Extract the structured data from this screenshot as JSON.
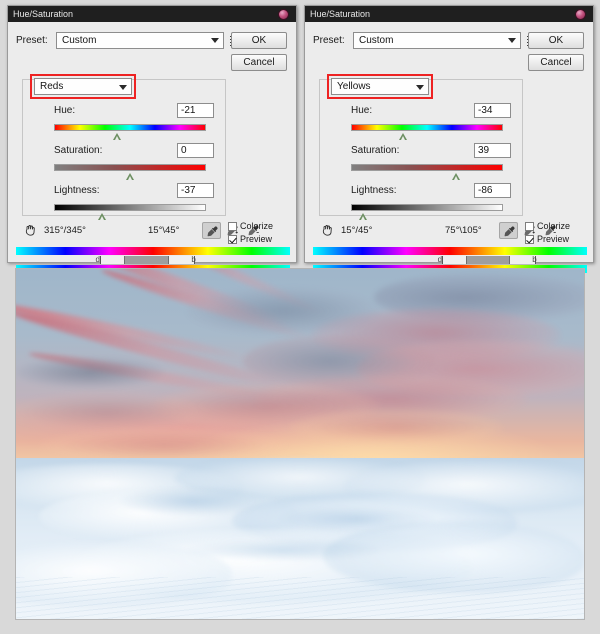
{
  "app": {
    "dialog_title": "Hue/Saturation"
  },
  "dialogs": [
    {
      "id": "reds",
      "title": "Hue/Saturation",
      "preset_label": "Preset:",
      "preset_value": "Custom",
      "buttons": {
        "ok": "OK",
        "cancel": "Cancel"
      },
      "channel": "Reds",
      "sliders": [
        {
          "name": "Hue:",
          "value": "-21",
          "thumb_pct": 41
        },
        {
          "name": "Saturation:",
          "value": "0",
          "thumb_pct": 50
        },
        {
          "name": "Lightness:",
          "value": "-37",
          "thumb_pct": 31
        }
      ],
      "range_left": "315°/345°",
      "range_right": "15°\\45°",
      "colorize_label": "Colorize",
      "colorize_checked": false,
      "preview_label": "Preview",
      "preview_checked": true,
      "spectrum": {
        "fall_start_pct": 30.5,
        "core_start_pct": 39.5,
        "core_end_pct": 56.0,
        "fall_end_pct": 65.0,
        "mark_left": "d",
        "mark_right": "b"
      }
    },
    {
      "id": "yellows",
      "title": "Hue/Saturation",
      "preset_label": "Preset:",
      "preset_value": "Custom",
      "buttons": {
        "ok": "OK",
        "cancel": "Cancel"
      },
      "channel": "Yellows",
      "sliders": [
        {
          "name": "Hue:",
          "value": "-34",
          "thumb_pct": 34
        },
        {
          "name": "Saturation:",
          "value": "39",
          "thumb_pct": 69
        },
        {
          "name": "Lightness:",
          "value": "-86",
          "thumb_pct": 7
        }
      ],
      "range_left": "15°/45°",
      "range_right": "75°\\105°",
      "colorize_label": "Colorize",
      "colorize_checked": false,
      "preview_label": "Preview",
      "preview_checked": true,
      "spectrum": {
        "fall_start_pct": 47.0,
        "core_start_pct": 56.0,
        "core_end_pct": 72.0,
        "fall_end_pct": 81.0,
        "mark_left": "d",
        "mark_right": "b"
      }
    }
  ],
  "icons": {
    "preset_menu": "preset-menu-icon",
    "hand": "✋",
    "eyedropper": "eyedropper-icon",
    "eyedropper_plus": "eyedropper-plus-icon",
    "eyedropper_minus": "eyedropper-minus-icon",
    "orb": "ps-orb-icon"
  },
  "photo": {
    "name": "snow-dunes-sunset-photo",
    "alt": "Snow dunes under a pink and blue sunset sky with distant mountains"
  },
  "colors": {
    "highlight": "#ee2222",
    "dialog_bg": "#ececec",
    "titlebar_bg": "#1f1f1f",
    "page_bg": "#d9d9d9"
  }
}
